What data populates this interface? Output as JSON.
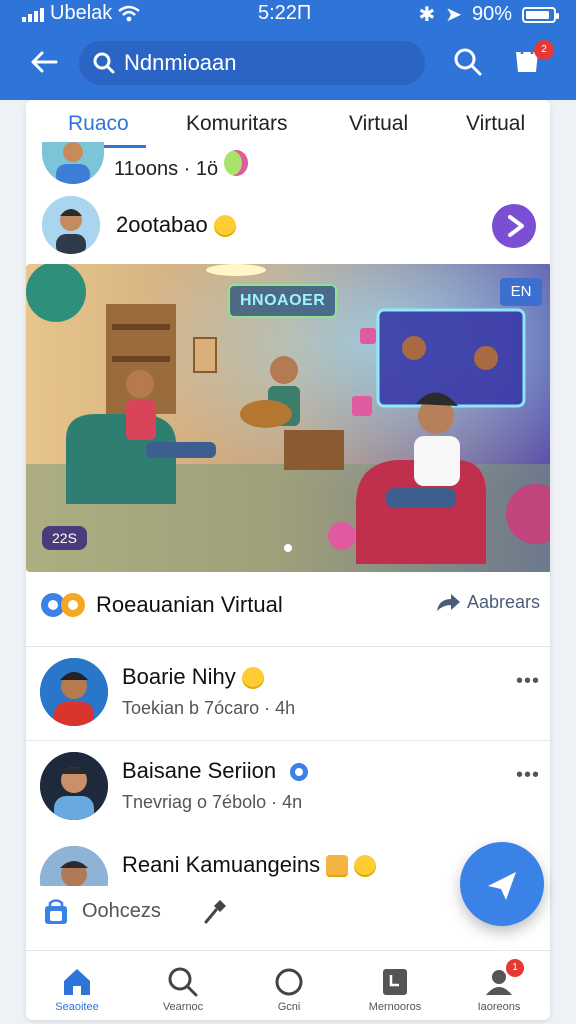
{
  "status": {
    "carrier": "Ubelak",
    "time": "5:22Π",
    "battery": "90%",
    "battery_level": 0.9
  },
  "appbar": {
    "search_value": "Ndnmioaan",
    "cart_badge": "2"
  },
  "tabs": [
    {
      "label": "Ruaco"
    },
    {
      "label": "Komuritars"
    },
    {
      "label": "Virtual"
    },
    {
      "label": "Virtual"
    }
  ],
  "feed": {
    "row1_text": "11oons · 1ö",
    "row2_text": "2ootabao"
  },
  "hero": {
    "badge": "HNOAOER",
    "lang_badge": "EN",
    "count": "22S"
  },
  "room": {
    "label": "Roeauanian Virtual",
    "share_label": "Aabrears"
  },
  "posts": [
    {
      "name": "Boarie Nihy",
      "meta": "Toekian b  7ócaro · 4h"
    },
    {
      "name": "Baisane Seriion",
      "meta": "Tnevriag o  7ébolo · 4n"
    },
    {
      "name": "Reani Kamuangeins",
      "meta": ""
    }
  ],
  "compose": {
    "placeholder": "Oohcezs"
  },
  "bottom_nav": [
    {
      "label": "Seaoitee"
    },
    {
      "label": "Vearnoc"
    },
    {
      "label": "Gcni"
    },
    {
      "label": "Mernooros"
    },
    {
      "label": "Iaoreons",
      "badge": "1"
    }
  ],
  "colors": {
    "accent": "#2f74d8",
    "purple": "#7a4fd4",
    "badge_red": "#e53935"
  },
  "icons": [
    "back-arrow-icon",
    "search-icon",
    "cart-icon",
    "play-icon",
    "share-icon",
    "more-icon",
    "send-icon",
    "home-icon",
    "explore-icon",
    "circle-icon",
    "bookmark-icon",
    "profile-icon",
    "mic-icon"
  ]
}
